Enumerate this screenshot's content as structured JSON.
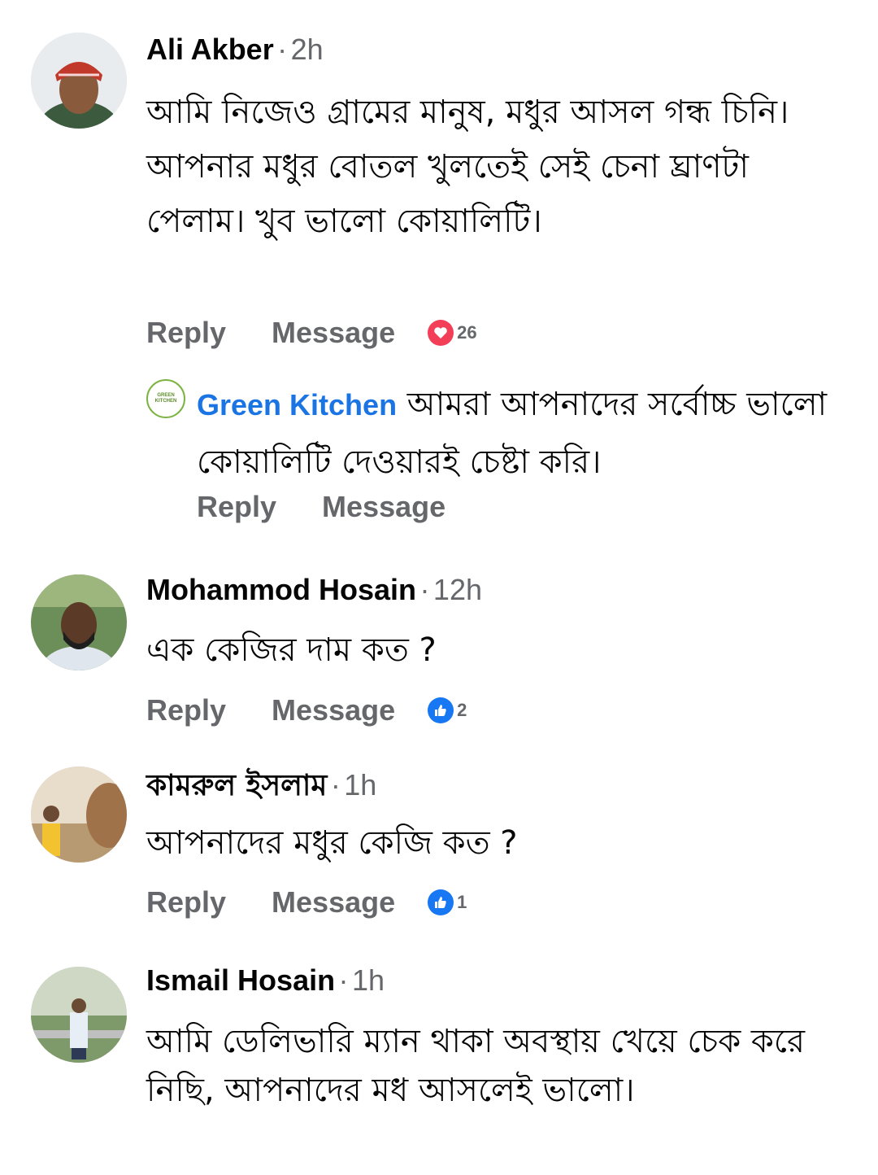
{
  "comments": [
    {
      "author": "Ali Akber",
      "separator": "·",
      "time": "2h",
      "text": "আমি নিজেও গ্রামের মানুষ, মধুর আসল গন্ধ চিনি। আপনার মধুর বোতল খুলতেই সেই চেনা ঘ্রাণটা পেলাম। খুব ভালো কোয়ালিটি।",
      "reply_label": "Reply",
      "message_label": "Message",
      "reaction": {
        "type": "heart-icon",
        "count": "26",
        "color": "#f33e58"
      },
      "page_reply": {
        "page_name": "Green Kitchen",
        "logo_text": "GREEN KITCHEN",
        "text": "আমরা আপনাদের সর্বোচ্চ ভালো কোয়ালিটি দেওয়ারই চেষ্টা করি।",
        "reply_label": "Reply",
        "message_label": "Message"
      }
    },
    {
      "author": "Mohammod Hosain",
      "separator": "·",
      "time": "12h",
      "text": "এক কেজির দাম কত ?",
      "reply_label": "Reply",
      "message_label": "Message",
      "reaction": {
        "type": "like-icon",
        "count": "2",
        "color": "#1877f2"
      }
    },
    {
      "author": "কামরুল ইসলাম",
      "separator": "·",
      "time": "1h",
      "text": "আপনাদের মধুর কেজি কত ?",
      "reply_label": "Reply",
      "message_label": "Message",
      "reaction": {
        "type": "like-icon",
        "count": "1",
        "color": "#1877f2"
      }
    },
    {
      "author": "Ismail Hosain",
      "separator": "·",
      "time": "1h",
      "text": "আমি ডেলিভারি ম্যান থাকা অবস্থায় খেয়ে চেক করে নিছি, আপনাদের মধ আসলেই ভালো।"
    }
  ]
}
